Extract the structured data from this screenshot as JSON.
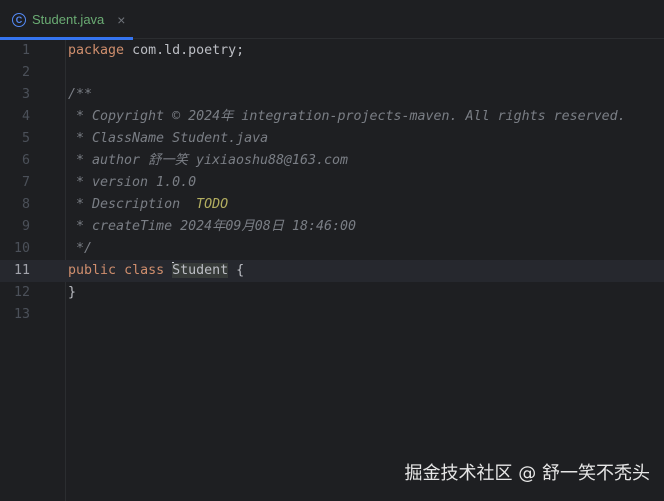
{
  "tab": {
    "title": "Student.java",
    "icon": "class-icon",
    "icon_letter": "C",
    "close": "×"
  },
  "lines": [
    {
      "n": "1",
      "parts": [
        [
          "kw",
          "package"
        ],
        [
          "",
          "com.ld.poetry;"
        ]
      ]
    },
    {
      "n": "2",
      "parts": []
    },
    {
      "n": "3",
      "parts": [
        [
          "cm",
          "/**"
        ]
      ]
    },
    {
      "n": "4",
      "parts": [
        [
          "cm",
          " * Copyright © 2024年 integration-projects-maven. All rights reserved."
        ]
      ]
    },
    {
      "n": "5",
      "parts": [
        [
          "cm",
          " * ClassName Student.java"
        ]
      ]
    },
    {
      "n": "6",
      "parts": [
        [
          "cm",
          " * author 舒一笑 yixiaoshu88@163.com"
        ]
      ]
    },
    {
      "n": "7",
      "parts": [
        [
          "cm",
          " * version 1.0.0"
        ]
      ]
    },
    {
      "n": "8",
      "parts": [
        [
          "cm",
          " * Description "
        ],
        [
          "todo",
          "TODO"
        ]
      ]
    },
    {
      "n": "9",
      "parts": [
        [
          "cm",
          " * createTime 2024年09月08日 18:46:00"
        ]
      ]
    },
    {
      "n": "10",
      "parts": [
        [
          "cm",
          " */"
        ]
      ]
    },
    {
      "n": "11",
      "parts": [
        [
          "kw",
          "public"
        ],
        [
          "kw",
          "class"
        ],
        [
          "caret",
          ""
        ],
        [
          "hl",
          "Student"
        ],
        [
          "",
          "{"
        ]
      ],
      "current": true
    },
    {
      "n": "12",
      "parts": [
        [
          "",
          "}"
        ]
      ]
    },
    {
      "n": "13",
      "parts": []
    }
  ],
  "watermark": "掘金技术社区 @ 舒一笑不秃头"
}
